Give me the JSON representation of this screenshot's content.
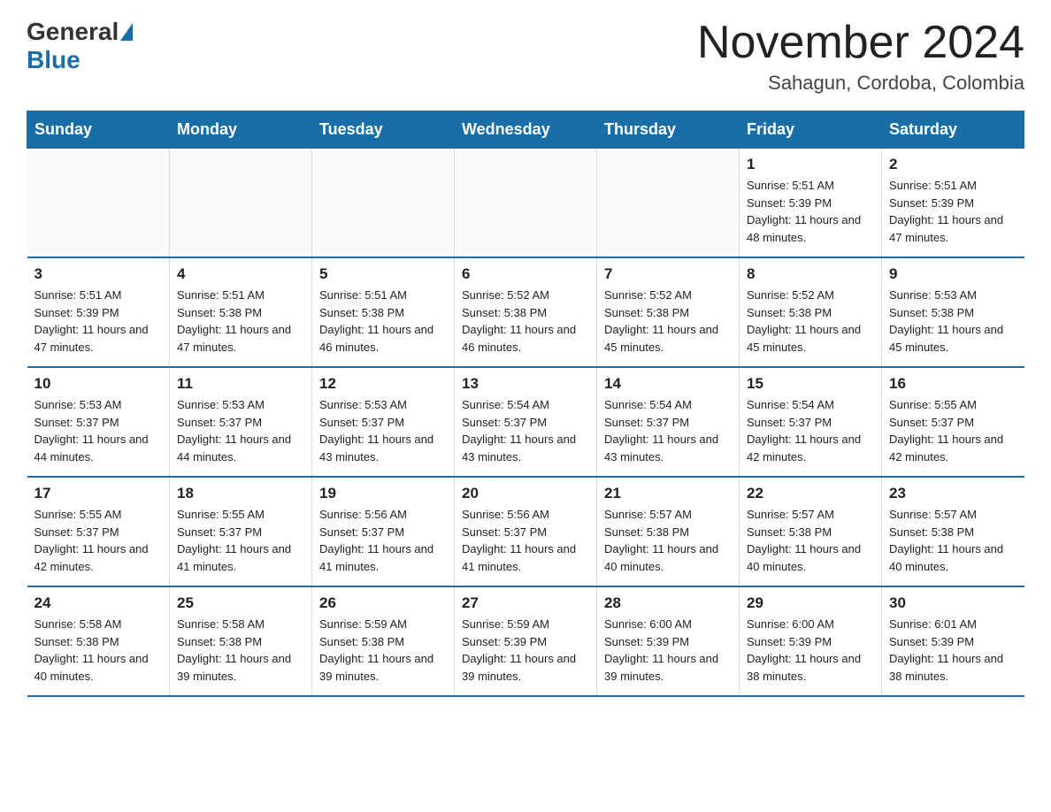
{
  "header": {
    "logo_general": "General",
    "logo_blue": "Blue",
    "month_title": "November 2024",
    "location": "Sahagun, Cordoba, Colombia"
  },
  "calendar": {
    "days_of_week": [
      "Sunday",
      "Monday",
      "Tuesday",
      "Wednesday",
      "Thursday",
      "Friday",
      "Saturday"
    ],
    "weeks": [
      [
        {
          "day": "",
          "info": ""
        },
        {
          "day": "",
          "info": ""
        },
        {
          "day": "",
          "info": ""
        },
        {
          "day": "",
          "info": ""
        },
        {
          "day": "",
          "info": ""
        },
        {
          "day": "1",
          "info": "Sunrise: 5:51 AM\nSunset: 5:39 PM\nDaylight: 11 hours and 48 minutes."
        },
        {
          "day": "2",
          "info": "Sunrise: 5:51 AM\nSunset: 5:39 PM\nDaylight: 11 hours and 47 minutes."
        }
      ],
      [
        {
          "day": "3",
          "info": "Sunrise: 5:51 AM\nSunset: 5:39 PM\nDaylight: 11 hours and 47 minutes."
        },
        {
          "day": "4",
          "info": "Sunrise: 5:51 AM\nSunset: 5:38 PM\nDaylight: 11 hours and 47 minutes."
        },
        {
          "day": "5",
          "info": "Sunrise: 5:51 AM\nSunset: 5:38 PM\nDaylight: 11 hours and 46 minutes."
        },
        {
          "day": "6",
          "info": "Sunrise: 5:52 AM\nSunset: 5:38 PM\nDaylight: 11 hours and 46 minutes."
        },
        {
          "day": "7",
          "info": "Sunrise: 5:52 AM\nSunset: 5:38 PM\nDaylight: 11 hours and 45 minutes."
        },
        {
          "day": "8",
          "info": "Sunrise: 5:52 AM\nSunset: 5:38 PM\nDaylight: 11 hours and 45 minutes."
        },
        {
          "day": "9",
          "info": "Sunrise: 5:53 AM\nSunset: 5:38 PM\nDaylight: 11 hours and 45 minutes."
        }
      ],
      [
        {
          "day": "10",
          "info": "Sunrise: 5:53 AM\nSunset: 5:37 PM\nDaylight: 11 hours and 44 minutes."
        },
        {
          "day": "11",
          "info": "Sunrise: 5:53 AM\nSunset: 5:37 PM\nDaylight: 11 hours and 44 minutes."
        },
        {
          "day": "12",
          "info": "Sunrise: 5:53 AM\nSunset: 5:37 PM\nDaylight: 11 hours and 43 minutes."
        },
        {
          "day": "13",
          "info": "Sunrise: 5:54 AM\nSunset: 5:37 PM\nDaylight: 11 hours and 43 minutes."
        },
        {
          "day": "14",
          "info": "Sunrise: 5:54 AM\nSunset: 5:37 PM\nDaylight: 11 hours and 43 minutes."
        },
        {
          "day": "15",
          "info": "Sunrise: 5:54 AM\nSunset: 5:37 PM\nDaylight: 11 hours and 42 minutes."
        },
        {
          "day": "16",
          "info": "Sunrise: 5:55 AM\nSunset: 5:37 PM\nDaylight: 11 hours and 42 minutes."
        }
      ],
      [
        {
          "day": "17",
          "info": "Sunrise: 5:55 AM\nSunset: 5:37 PM\nDaylight: 11 hours and 42 minutes."
        },
        {
          "day": "18",
          "info": "Sunrise: 5:55 AM\nSunset: 5:37 PM\nDaylight: 11 hours and 41 minutes."
        },
        {
          "day": "19",
          "info": "Sunrise: 5:56 AM\nSunset: 5:37 PM\nDaylight: 11 hours and 41 minutes."
        },
        {
          "day": "20",
          "info": "Sunrise: 5:56 AM\nSunset: 5:37 PM\nDaylight: 11 hours and 41 minutes."
        },
        {
          "day": "21",
          "info": "Sunrise: 5:57 AM\nSunset: 5:38 PM\nDaylight: 11 hours and 40 minutes."
        },
        {
          "day": "22",
          "info": "Sunrise: 5:57 AM\nSunset: 5:38 PM\nDaylight: 11 hours and 40 minutes."
        },
        {
          "day": "23",
          "info": "Sunrise: 5:57 AM\nSunset: 5:38 PM\nDaylight: 11 hours and 40 minutes."
        }
      ],
      [
        {
          "day": "24",
          "info": "Sunrise: 5:58 AM\nSunset: 5:38 PM\nDaylight: 11 hours and 40 minutes."
        },
        {
          "day": "25",
          "info": "Sunrise: 5:58 AM\nSunset: 5:38 PM\nDaylight: 11 hours and 39 minutes."
        },
        {
          "day": "26",
          "info": "Sunrise: 5:59 AM\nSunset: 5:38 PM\nDaylight: 11 hours and 39 minutes."
        },
        {
          "day": "27",
          "info": "Sunrise: 5:59 AM\nSunset: 5:39 PM\nDaylight: 11 hours and 39 minutes."
        },
        {
          "day": "28",
          "info": "Sunrise: 6:00 AM\nSunset: 5:39 PM\nDaylight: 11 hours and 39 minutes."
        },
        {
          "day": "29",
          "info": "Sunrise: 6:00 AM\nSunset: 5:39 PM\nDaylight: 11 hours and 38 minutes."
        },
        {
          "day": "30",
          "info": "Sunrise: 6:01 AM\nSunset: 5:39 PM\nDaylight: 11 hours and 38 minutes."
        }
      ]
    ]
  }
}
